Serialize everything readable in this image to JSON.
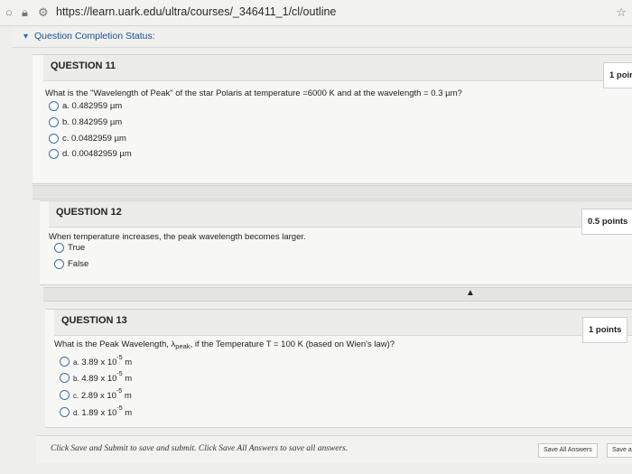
{
  "browser": {
    "url": "https://learn.uark.edu/ultra/courses/_346411_1/cl/outline"
  },
  "status": {
    "label": "Question Completion Status:"
  },
  "questions": [
    {
      "title": "QUESTION 11",
      "points": "1 poir",
      "prompt": "What is the \"Wavelength of Peak\" of the star Polaris at temperature =6000 K and at the wavelength = 0.3 µm?",
      "options": [
        "a. 0.482959 µm",
        "b. 0.842959 µm",
        "c. 0.0482959 µm",
        "d. 0.00482959 µm"
      ]
    },
    {
      "title": "QUESTION 12",
      "points": "0.5 points",
      "prompt": "When temperature increases, the peak wavelength becomes larger.",
      "options": [
        "True",
        "False"
      ]
    },
    {
      "title": "QUESTION 13",
      "points": "1 points",
      "prompt_pre": "What is the Peak Wavelength, λ",
      "prompt_sub": "peak",
      "prompt_post": ", if the Temperature T = 100 K (based on Wien's law)?",
      "options": [
        {
          "letter": "a.",
          "mantissa": "3.89 x 10",
          "exp": "-5",
          "unit": "m"
        },
        {
          "letter": "b.",
          "mantissa": "4.89 x 10",
          "exp": "-5",
          "unit": "m"
        },
        {
          "letter": "c.",
          "mantissa": "2.89 x 10",
          "exp": "-5",
          "unit": "m"
        },
        {
          "letter": "d.",
          "mantissa": "1.89 x 10",
          "exp": "-5",
          "unit": "m"
        }
      ]
    }
  ],
  "footer": {
    "message": "Click Save and Submit to save and submit. Click Save All Answers to save all answers.",
    "save_all": "Save All Answers",
    "save_submit": "Save a"
  }
}
